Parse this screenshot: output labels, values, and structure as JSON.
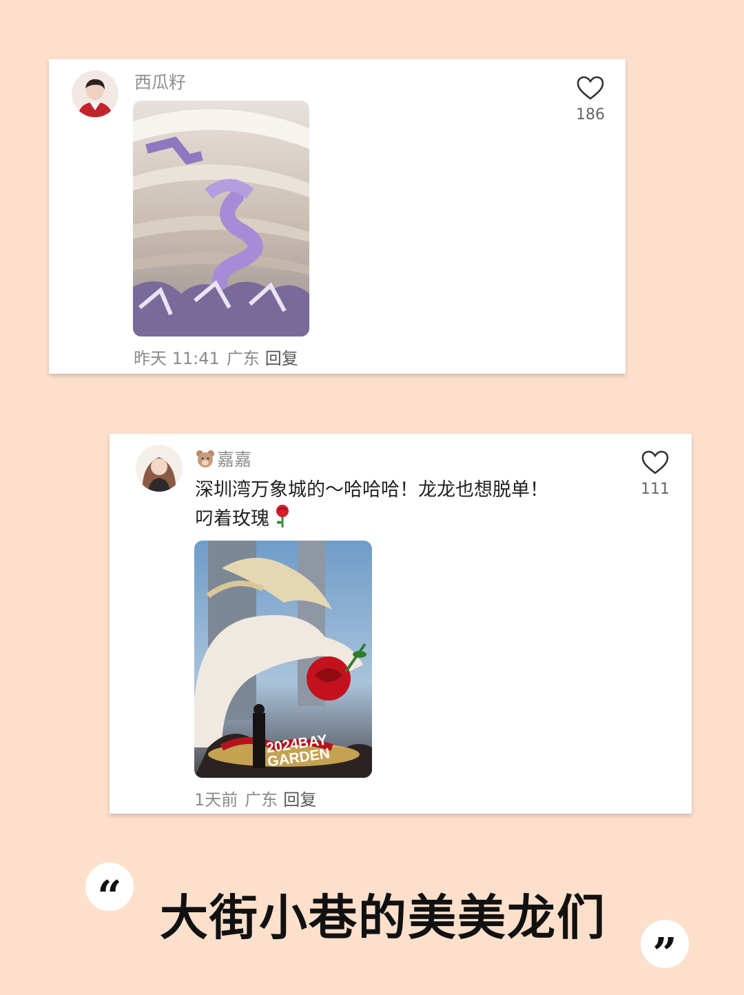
{
  "comments": [
    {
      "username": "西瓜籽",
      "text": "",
      "time": "昨天 11:41",
      "location": "广东",
      "reply_label": "回复",
      "likes": "186",
      "avatar_icon": "male-avatar",
      "like_icon": "heart-outline-icon"
    },
    {
      "username": "嘉嘉",
      "username_badge_icon": "bear-emoji-icon",
      "text_line1": "深圳湾万象城的～哈哈哈！龙龙也想脱单！",
      "text_line2": "叼着玫瑰",
      "text_emoji_icon": "rose-emoji-icon",
      "photo_text": "2024BAY GARDEN",
      "time": "1天前",
      "location": "广东",
      "reply_label": "回复",
      "likes": "111",
      "avatar_icon": "female-avatar",
      "like_icon": "heart-outline-icon"
    }
  ],
  "headline": "大街小巷的美美龙们",
  "quote_open": "“",
  "quote_close": "”",
  "colors": {
    "background": "#fde0cb",
    "card": "#ffffff",
    "meta_text": "#8a8a8a"
  }
}
